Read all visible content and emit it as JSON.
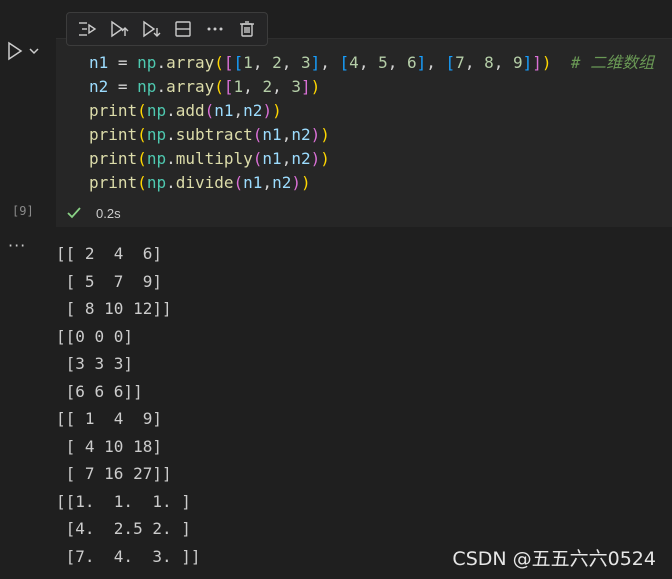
{
  "toolbar": {
    "icons": [
      "run-by-line-icon",
      "execute-above-icon",
      "execute-below-icon",
      "split-cell-icon",
      "more-actions-icon",
      "delete-cell-icon"
    ]
  },
  "cell": {
    "execution_count": "[9]",
    "duration": "0.2s",
    "status": "success",
    "code": [
      "n1 = np.array([[1, 2, 3], [4, 5, 6], [7, 8, 9]])  # 二维数组",
      "n2 = np.array([1, 2, 3])",
      "print(np.add(n1,n2))",
      "print(np.subtract(n1,n2))",
      "print(np.multiply(n1,n2))",
      "print(np.divide(n1,n2))"
    ]
  },
  "output": {
    "more_label": "···",
    "lines": [
      "[[ 2  4  6]",
      " [ 5  7  9]",
      " [ 8 10 12]]",
      "[[0 0 0]",
      " [3 3 3]",
      " [6 6 6]]",
      "[[ 1  4  9]",
      " [ 4 10 18]",
      " [ 7 16 27]]",
      "[[1.  1.  1. ]",
      " [4.  2.5 2. ]",
      " [7.  4.  3. ]]"
    ]
  },
  "watermark": "CSDN @五五六六0524",
  "colors": {
    "background": "#1f1f1f",
    "editor_bg": "#262626",
    "success": "#89d185"
  }
}
